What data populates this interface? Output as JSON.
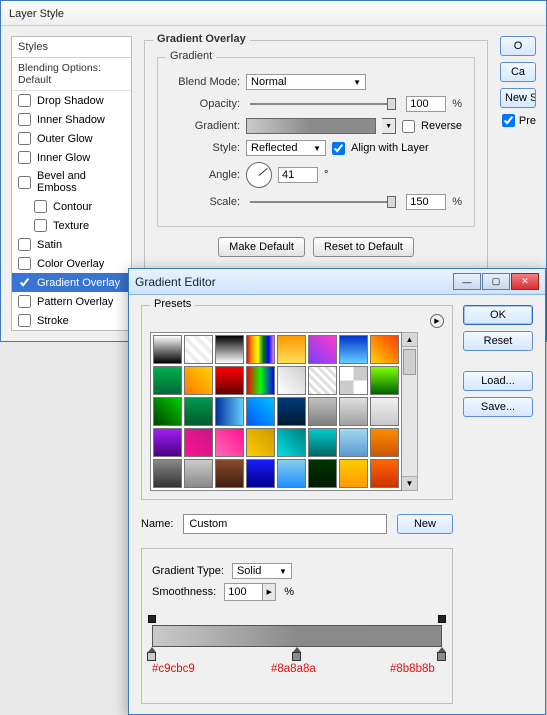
{
  "layerStyle": {
    "title": "Layer Style",
    "stylesHeader": "Styles",
    "blendingOptions": "Blending Options: Default",
    "items": [
      {
        "label": "Drop Shadow",
        "checked": false
      },
      {
        "label": "Inner Shadow",
        "checked": false
      },
      {
        "label": "Outer Glow",
        "checked": false
      },
      {
        "label": "Inner Glow",
        "checked": false
      },
      {
        "label": "Bevel and Emboss",
        "checked": false
      },
      {
        "label": "Contour",
        "checked": false,
        "indent": true
      },
      {
        "label": "Texture",
        "checked": false,
        "indent": true
      },
      {
        "label": "Satin",
        "checked": false
      },
      {
        "label": "Color Overlay",
        "checked": false
      },
      {
        "label": "Gradient Overlay",
        "checked": true,
        "selected": true
      },
      {
        "label": "Pattern Overlay",
        "checked": false
      },
      {
        "label": "Stroke",
        "checked": false
      }
    ],
    "panelTitle": "Gradient Overlay",
    "innerTitle": "Gradient",
    "labels": {
      "blendMode": "Blend Mode:",
      "opacity": "Opacity:",
      "gradient": "Gradient:",
      "style": "Style:",
      "angle": "Angle:",
      "scale": "Scale:",
      "reverse": "Reverse",
      "align": "Align with Layer",
      "deg": "°",
      "pct": "%"
    },
    "values": {
      "blendMode": "Normal",
      "opacity": "100",
      "style": "Reflected",
      "angle": "41",
      "scale": "150",
      "reverse": false,
      "align": true
    },
    "btns": {
      "makeDefault": "Make Default",
      "resetDefault": "Reset to Default"
    },
    "right": {
      "ok": "O",
      "cancel": "Ca",
      "newStyle": "New S",
      "preview": "Pre"
    }
  },
  "gradEditor": {
    "title": "Gradient Editor",
    "btns": {
      "ok": "OK",
      "reset": "Reset",
      "load": "Load...",
      "save": "Save...",
      "new": "New"
    },
    "presetsLabel": "Presets",
    "presets": [
      "linear-gradient(#fff,#000)",
      "repeating-linear-gradient(45deg,#eee 0 4px,#fff 4px 8px)",
      "linear-gradient(#000,#fff)",
      "linear-gradient(90deg,red,orange,yellow,green,blue,violet)",
      "linear-gradient(#ff9a00,#ffde59)",
      "linear-gradient(45deg,#7a3cff,#ff3cc7)",
      "linear-gradient(#0033cc,#66ccff)",
      "linear-gradient(45deg,#ffd400,#ff3c00)",
      "linear-gradient(#00b050,#006837)",
      "linear-gradient(45deg,#ff7a00,#ffd400)",
      "linear-gradient(#ff0000,#660000)",
      "linear-gradient(90deg,#ff0000,#00ff00,#0000ff)",
      "linear-gradient(45deg,#fff,#cfcfcf)",
      "repeating-linear-gradient(45deg,#e0e0e0 0 3px,#fff 3px 6px)",
      "repeating-conic-gradient(#ccc 0 25%,#fff 0 50%)",
      "linear-gradient(#7fff00,#006400)",
      "linear-gradient(45deg,#004400,#00cc00)",
      "linear-gradient(#00994d,#005c2e)",
      "linear-gradient(90deg,#003399,#66ccff)",
      "linear-gradient(45deg,#0055ff,#00c2ff)",
      "linear-gradient(#003c78,#001a33)",
      "linear-gradient(#c0c0c0,#808080)",
      "linear-gradient(#e0e0e0,#a0a0a0)",
      "linear-gradient(#f0f0f0,#c8c8c8)",
      "linear-gradient(#a020f0,#4b0082)",
      "linear-gradient(45deg,#ff1493,#c71585)",
      "linear-gradient(45deg,#ff69b4,#ff1493)",
      "linear-gradient(45deg,#ffcc00,#cc9900)",
      "linear-gradient(45deg,#00e0e0,#007e7e)",
      "linear-gradient(#00cccc,#006666)",
      "linear-gradient(#a0d8ef,#5c9bd1)",
      "linear-gradient(#ff8c00,#cc5500)",
      "linear-gradient(#888,#333)",
      "linear-gradient(#ccc,#888)",
      "linear-gradient(#8a4b2e,#3e1f0d)",
      "linear-gradient(#1a1aff,#00008b)",
      "linear-gradient(#87ceeb,#1e90ff)",
      "linear-gradient(#003300,#001a00)",
      "linear-gradient(#ffcc00,#ff9900)",
      "linear-gradient(#ff6600,#cc3300)"
    ],
    "nameLabel": "Name:",
    "nameValue": "Custom",
    "gtLabel": "Gradient Type:",
    "gtValue": "Solid",
    "smoothLabel": "Smoothness:",
    "smoothValue": "100",
    "pct": "%",
    "stops": {
      "opacity": [
        {
          "pos": 0
        },
        {
          "pos": 100
        }
      ],
      "color": [
        {
          "pos": 0,
          "hex": "#c9cbc9"
        },
        {
          "pos": 50,
          "hex": "#8a8a8a"
        },
        {
          "pos": 100,
          "hex": "#8b8b8b"
        }
      ]
    }
  }
}
